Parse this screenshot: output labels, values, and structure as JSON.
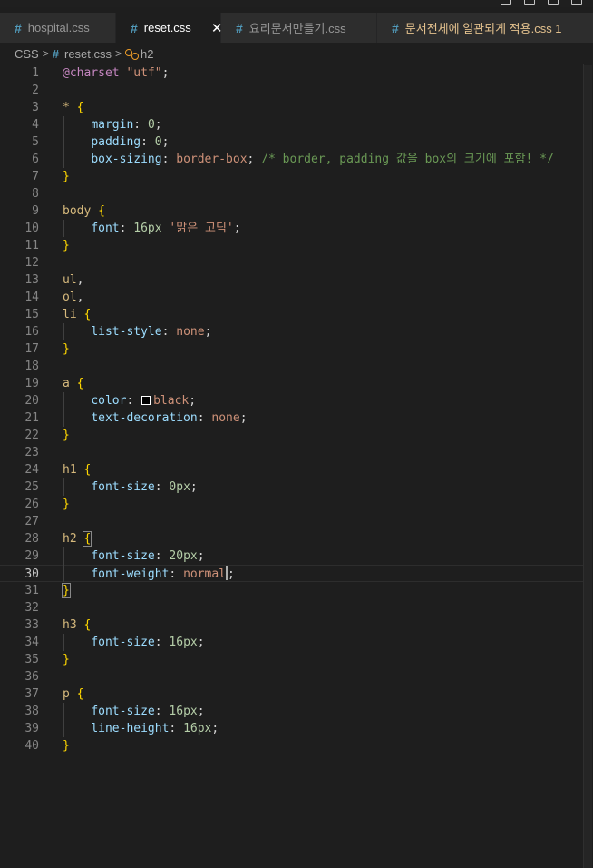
{
  "tabs": [
    {
      "label": "hospital.css",
      "active": false
    },
    {
      "label": "reset.css",
      "active": true
    },
    {
      "label": "요리문서만들기.css",
      "active": false
    },
    {
      "label": "문서전체에 일관되게 적용.css 1",
      "active": false,
      "modified": true
    }
  ],
  "breadcrumb": {
    "folder": "CSS",
    "file": "reset.css",
    "symbol": "h2"
  },
  "editor": {
    "current_line": 30,
    "line_numbers": [
      "1",
      "2",
      "3",
      "4",
      "5",
      "6",
      "7",
      "8",
      "9",
      "10",
      "11",
      "12",
      "13",
      "14",
      "15",
      "16",
      "17",
      "18",
      "19",
      "20",
      "21",
      "22",
      "23",
      "24",
      "25",
      "26",
      "27",
      "28",
      "29",
      "30",
      "31",
      "32",
      "33",
      "34",
      "35",
      "36",
      "37",
      "38",
      "39",
      "40"
    ],
    "lines": [
      "@charset \"utf\";",
      "",
      "* {",
      "    margin: 0;",
      "    padding: 0;",
      "    box-sizing: border-box; /* border, padding 값을 box의 크기에 포함! */",
      "}",
      "",
      "body {",
      "    font: 16px '맑은 고딕';",
      "}",
      "",
      "ul,",
      "ol,",
      "li {",
      "    list-style: none;",
      "}",
      "",
      "a {",
      "    color: black;",
      "    text-decoration: none;",
      "}",
      "",
      "h1 {",
      "    font-size: 0px;",
      "}",
      "",
      "h2 {",
      "    font-size: 20px;",
      "    font-weight: normal;",
      "}",
      "",
      "h3 {",
      "    font-size: 16px;",
      "}",
      "",
      "p {",
      "    font-size: 16px;",
      "    line-height: 16px;",
      "}"
    ]
  },
  "colors": {
    "background": "#1e1e1e",
    "selector": "#d7ba7d",
    "property": "#9cdcfe",
    "value": "#ce9178",
    "number": "#b5cea8",
    "comment": "#6a9955",
    "bracket": "#ffd700",
    "swatch_black": "#000000"
  },
  "icons": {
    "tab_file": "css-hash-icon",
    "tab_close": "close-icon",
    "breadcrumb_sep": "chevron-right-icon",
    "symbol": "symbol-class-icon"
  }
}
